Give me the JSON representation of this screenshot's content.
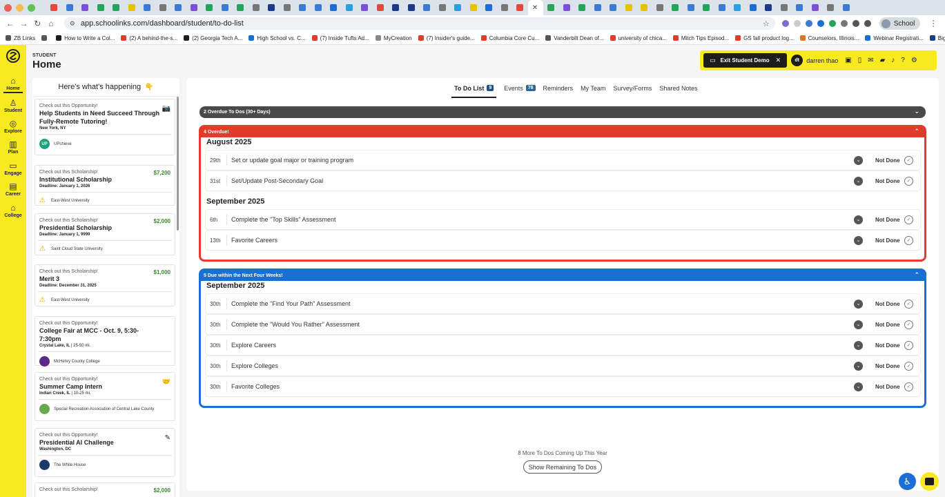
{
  "browser": {
    "url": "app.schoolinks.com/dashboard/student/to-do-list",
    "profile_label": "School",
    "tab_colors": [
      "#e24b3b",
      "#3a7bd5",
      "#7b4fd6",
      "#23a55a",
      "#23a55a",
      "#e6c200",
      "#3a7bd5",
      "#777777",
      "#3a7bd5",
      "#7b4fd6",
      "#23a55a",
      "#3a7bd5",
      "#23a55a",
      "#777777",
      "#1d3b8a",
      "#777777",
      "#3a7bd5",
      "#3a7bd5",
      "#1a6fd6",
      "#2aa0e0",
      "#7b4fd6",
      "#e24b3b",
      "#1d3b8a",
      "#1d3b8a",
      "#3a7bd5",
      "#777777",
      "#2aa0e0",
      "#e6c200",
      "#1a6fd6",
      "#777777",
      "#e24b3b",
      "#777777",
      "#23a55a",
      "#7b4fd6",
      "#23a55a",
      "#3a7bd5",
      "#3a7bd5",
      "#e6c200",
      "#e6c200",
      "#777777",
      "#23a55a",
      "#3a7bd5",
      "#23a55a",
      "#3a7bd5",
      "#2aa0e0",
      "#1a6fd6",
      "#1d3b8a",
      "#777777",
      "#3a7bd5",
      "#7b4fd6",
      "#777777",
      "#3a7bd5"
    ],
    "bookmarks": [
      {
        "label": "ZB Links",
        "color": "#555555"
      },
      {
        "label": "",
        "color": "#555555"
      },
      {
        "label": "How to Write a Col...",
        "color": "#1d1d1d"
      },
      {
        "label": "(2) A behind-the-s...",
        "color": "#e23b2a"
      },
      {
        "label": "(2) Georgia Tech A...",
        "color": "#1d1d1d"
      },
      {
        "label": "High School vs. C...",
        "color": "#1a6fd6"
      },
      {
        "label": "(7) Inside Tufts Ad...",
        "color": "#e23b2a"
      },
      {
        "label": "MyCreation",
        "color": "#888888"
      },
      {
        "label": "(7) Insider's guide...",
        "color": "#e23b2a"
      },
      {
        "label": "Columbia Core Cu...",
        "color": "#e23b2a"
      },
      {
        "label": "Vanderbilt Dean of...",
        "color": "#555555"
      },
      {
        "label": "university of chica...",
        "color": "#e23b2a"
      },
      {
        "label": "Mitch Tips Episod...",
        "color": "#e23b2a"
      },
      {
        "label": "GS fall product log...",
        "color": "#e23b2a"
      },
      {
        "label": "Counselors, Illinois...",
        "color": "#e2742a"
      },
      {
        "label": "Webinar Registrati...",
        "color": "#1a6fd6"
      },
      {
        "label": "Big Ten Academic...",
        "color": "#1d3b8a"
      }
    ]
  },
  "sidebar": {
    "items": [
      {
        "label": "Home",
        "icon": "home-icon"
      },
      {
        "label": "Student",
        "icon": "student-icon"
      },
      {
        "label": "Explore",
        "icon": "compass-icon"
      },
      {
        "label": "Plan",
        "icon": "book-icon"
      },
      {
        "label": "Engage",
        "icon": "ticket-icon"
      },
      {
        "label": "Career",
        "icon": "briefcase-icon"
      },
      {
        "label": "College",
        "icon": "college-icon"
      }
    ]
  },
  "header": {
    "small_label": "STUDENT",
    "title": "Home",
    "exit_label": "Exit Student Demo",
    "user_initials": "dt",
    "user_name": "darren thao"
  },
  "feed": {
    "title": "Here's what's happening",
    "cards": [
      {
        "kicker": "Check out this Opportunity!",
        "amount": "",
        "title": "Help Students in Need Succeed Through Fully-Remote Tutoring!",
        "meta_bold": "New York, NY",
        "meta_rest": "",
        "org": "UPchieve",
        "org_badge": "UP",
        "org_color": "#16a37f"
      },
      {
        "kicker": "Check out this Scholarship!",
        "amount": "$7,200",
        "title": "Institutional Scholarship",
        "meta_bold": "Deadline: January 1, 2026",
        "meta_rest": "",
        "org": "East-West University",
        "org_badge": "",
        "org_color": ""
      },
      {
        "kicker": "Check out this Scholarship!",
        "amount": "$2,000",
        "title": "Presidential Scholarship",
        "meta_bold": "Deadline: January 1, 9999",
        "meta_rest": "",
        "org": "Saint Cloud State University",
        "org_badge": "",
        "org_color": ""
      },
      {
        "kicker": "Check out this Scholarship!",
        "amount": "$1,000",
        "title": "Merit 3",
        "meta_bold": "Deadline: December 31, 2025",
        "meta_rest": "",
        "org": "East-West University",
        "org_badge": "",
        "org_color": ""
      },
      {
        "kicker": "Check out this Opportunity!",
        "amount": "",
        "title": "College Fair at MCC - Oct. 9, 5:30-7:30pm",
        "meta_bold": "Crystal Lake, IL",
        "meta_rest": " | 25-50 mi.",
        "org": "McHenry County College",
        "org_badge": "",
        "org_color": "#5b2a86"
      },
      {
        "kicker": "Check out this Opportunity!",
        "amount": "",
        "title": "Summer Camp Intern",
        "meta_bold": "Indian Creek, IL",
        "meta_rest": " | 10-25 mi.",
        "org": "Special Recreation Association of Central Lake County",
        "org_badge": "",
        "org_color": "#6aa84f"
      },
      {
        "kicker": "Check out this Opportunity!",
        "amount": "",
        "title": "Presidential AI Challenge",
        "meta_bold": "Washington, DC",
        "meta_rest": "",
        "org": "The White House",
        "org_badge": "",
        "org_color": "#1d3b6a"
      },
      {
        "kicker": "Check out this Scholarship!",
        "amount": "$2,000",
        "title": "",
        "meta_bold": "",
        "meta_rest": "",
        "org": "",
        "org_badge": "",
        "org_color": ""
      }
    ]
  },
  "tabs": [
    {
      "label": "To Do List",
      "count": "9"
    },
    {
      "label": "Events",
      "count": "78"
    },
    {
      "label": "Reminders",
      "count": ""
    },
    {
      "label": "My Team",
      "count": ""
    },
    {
      "label": "Survey/Forms",
      "count": ""
    },
    {
      "label": "Shared Notes",
      "count": ""
    }
  ],
  "todo": {
    "overdue_old_label": "2 Overdue To Dos (30+ Days)",
    "overdue_label": "4 Overdue!",
    "overdue_groups": [
      {
        "month": "August 2025",
        "items": [
          {
            "day": "29th",
            "task": "Set or update goal major or training program",
            "status": "Not Done"
          },
          {
            "day": "31st",
            "task": "Set/Update Post-Secondary Goal",
            "status": "Not Done"
          }
        ]
      },
      {
        "month": "September 2025",
        "items": [
          {
            "day": "6th",
            "task": "Complete the \"Top Skills\" Assessment",
            "status": "Not Done"
          },
          {
            "day": "13th",
            "task": "Favorite Careers",
            "status": "Not Done"
          }
        ]
      }
    ],
    "upcoming_label": "5 Due within the Next Four Weeks!",
    "upcoming_groups": [
      {
        "month": "September 2025",
        "items": [
          {
            "day": "30th",
            "task": "Complete the \"Find Your Path\" Assessment",
            "status": "Not Done"
          },
          {
            "day": "30th",
            "task": "Complete the \"Would You Rather\" Assessment",
            "status": "Not Done"
          },
          {
            "day": "30th",
            "task": "Explore Careers",
            "status": "Not Done"
          },
          {
            "day": "30th",
            "task": "Explore Colleges",
            "status": "Not Done"
          },
          {
            "day": "30th",
            "task": "Favorite Colleges",
            "status": "Not Done"
          }
        ]
      }
    ],
    "more_text": "8 More To Dos Coming Up This Year",
    "show_button": "Show Remaining To Dos"
  },
  "colors": {
    "brand_yellow": "#f7ea20",
    "overdue_red": "#e23b2a",
    "upcoming_blue": "#1a6fd6",
    "amount_green": "#3a8a2a"
  }
}
